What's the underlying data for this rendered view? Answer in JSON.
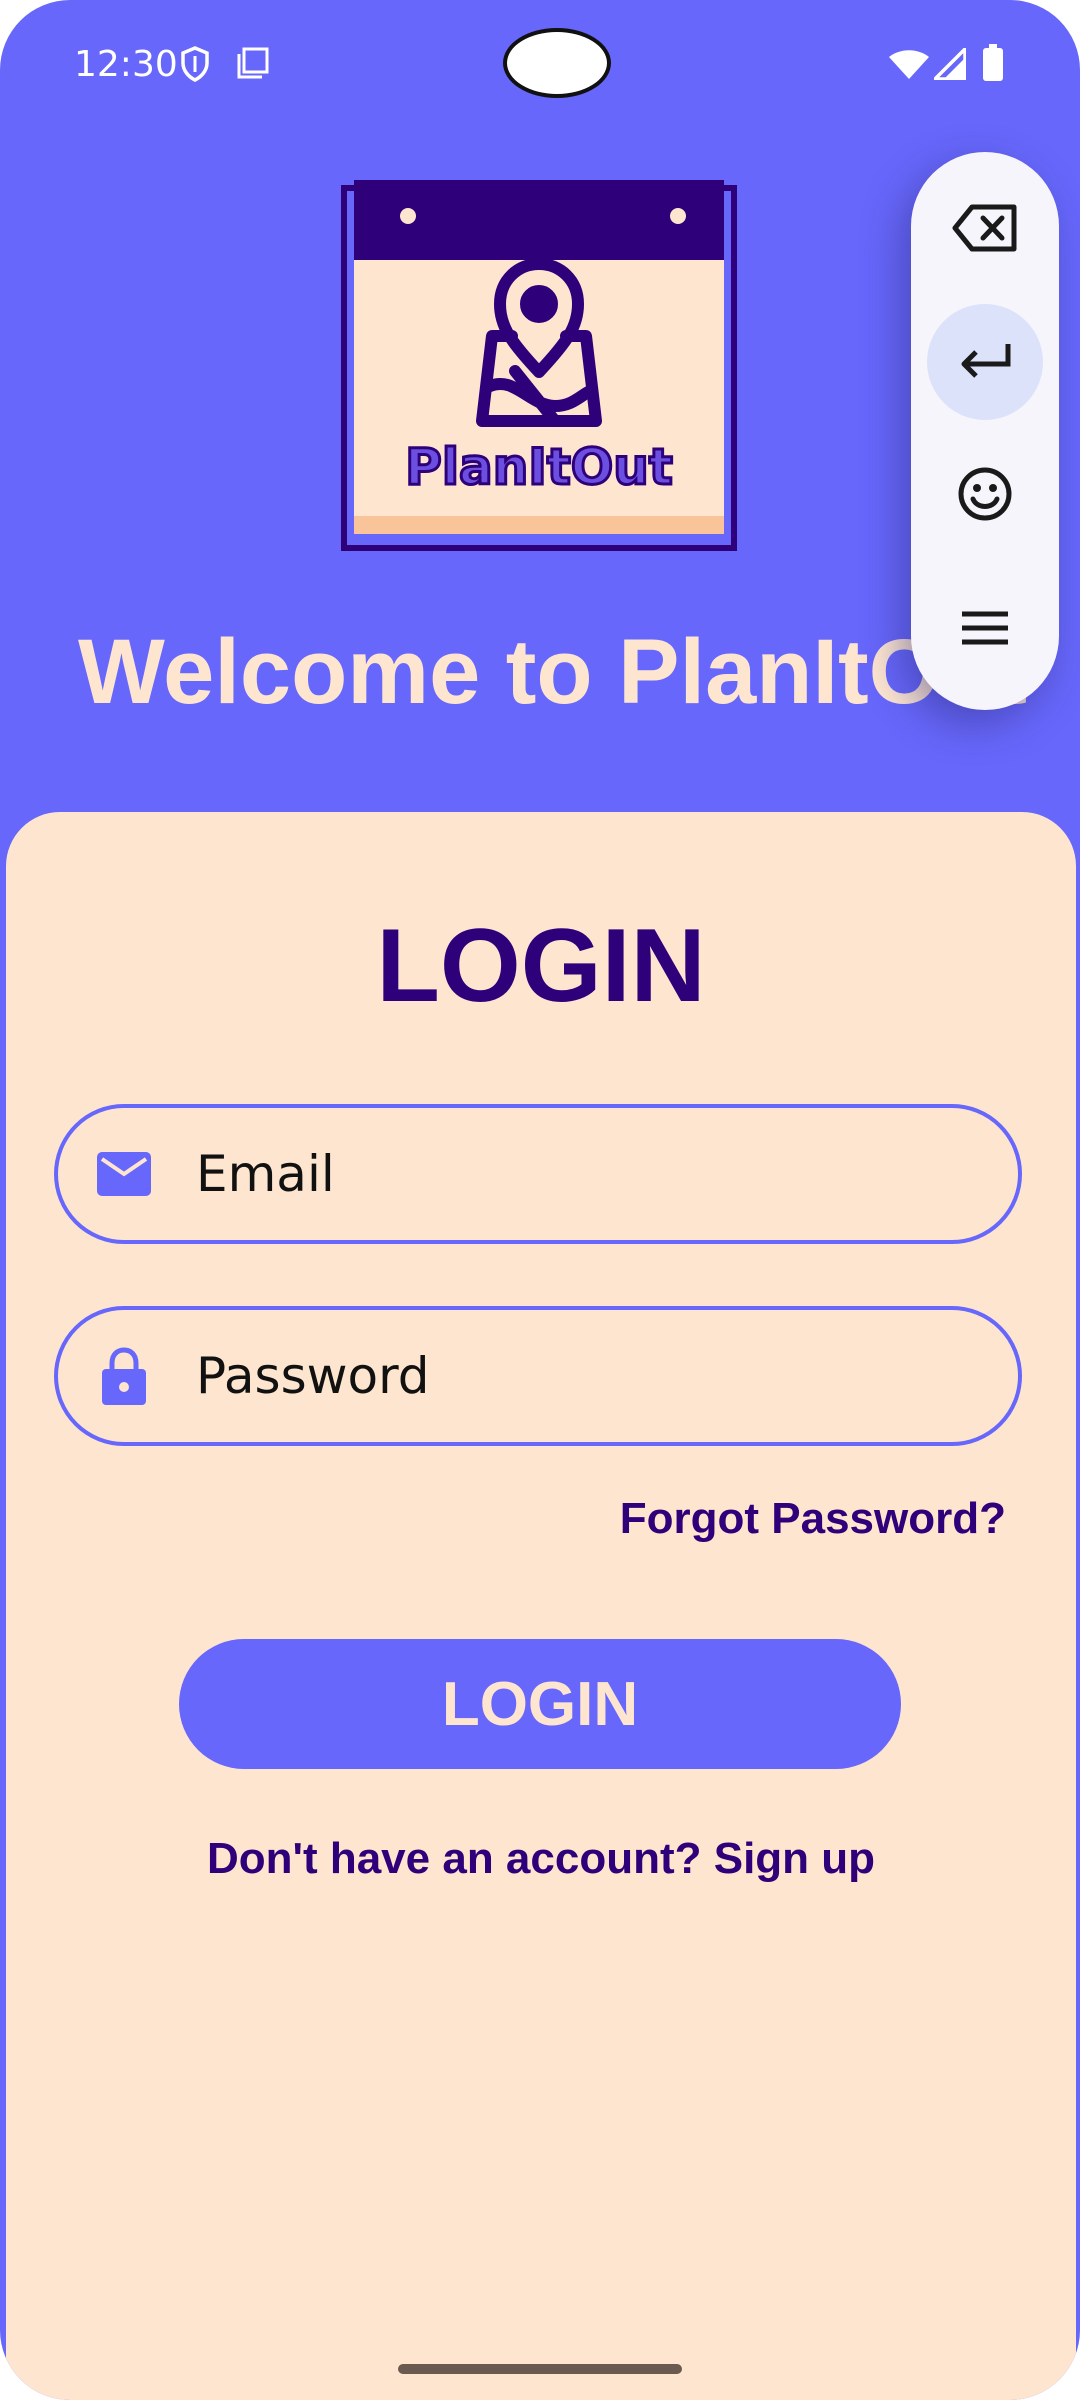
{
  "status_bar": {
    "time": "12:30",
    "icons": [
      "shield-icon",
      "screenshot-icon",
      "wifi-icon",
      "signal-icon",
      "battery-icon"
    ]
  },
  "header": {
    "logo_text": "PlanItOut",
    "welcome": "Welcome to PlanItOut"
  },
  "keyboard_toolbar": {
    "buttons": [
      "backspace-icon",
      "enter-icon",
      "emoji-icon",
      "menu-icon"
    ]
  },
  "login_card": {
    "title": "LOGIN",
    "email_placeholder": "Email",
    "password_placeholder": "Password",
    "forgot_password": "Forgot Password?",
    "login_button": "LOGIN",
    "signup_link": "Don't have an account? Sign up"
  },
  "colors": {
    "primary": "#6767fb",
    "card_background": "#fde5cf",
    "dark_purple": "#2e007a"
  }
}
